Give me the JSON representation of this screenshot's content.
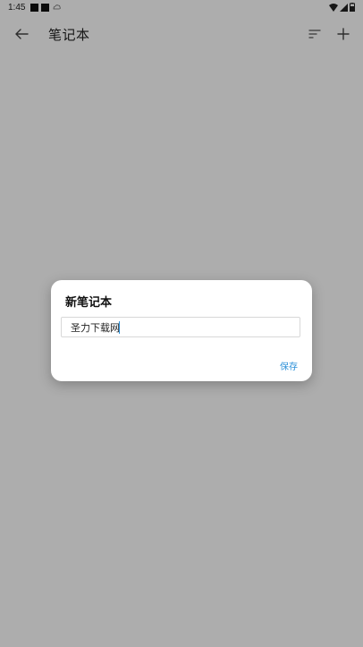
{
  "status_bar": {
    "time": "1:45"
  },
  "app_bar": {
    "title": "笔记本",
    "back_icon": "arrow-left-icon",
    "sort_icon": "sort-icon",
    "add_icon": "plus-icon"
  },
  "dialog": {
    "title": "新笔记本",
    "input_value": "圣力下载网",
    "save_label": "保存"
  },
  "colors": {
    "accent": "#2a8fd8",
    "scrim": "#adadad",
    "dialog_bg": "#ffffff"
  }
}
